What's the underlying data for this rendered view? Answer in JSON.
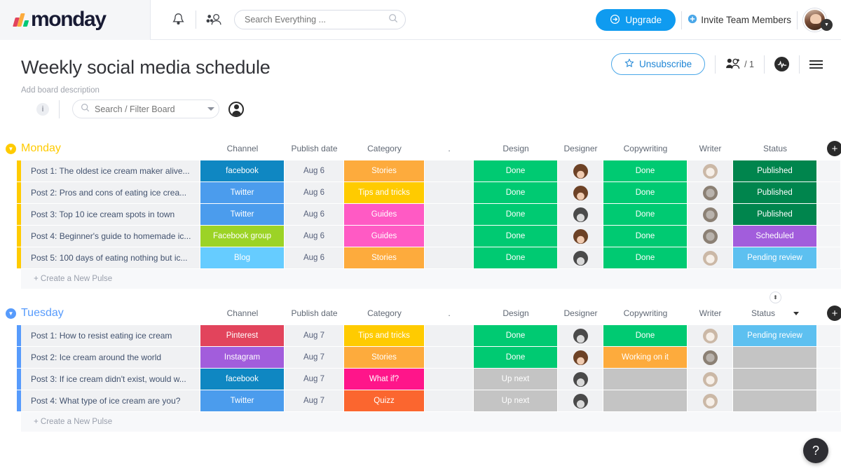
{
  "topbar": {
    "logo_text": "monday",
    "notifications_icon": "bell-icon",
    "teammates_icon": "people-icon",
    "search_placeholder": "Search Everything ...",
    "search_value": "",
    "search_icon": "search-icon",
    "upgrade_label": "Upgrade",
    "upgrade_icon": "arrow-circle-icon",
    "invite_label": "Invite Team Members",
    "invite_icon": "plus-circle-icon",
    "avatar": "user-avatar",
    "avatar_caret_icon": "chevron-down-icon",
    "accent_blue": "#0f9bf0"
  },
  "board_header": {
    "title": "Weekly social media schedule",
    "description_placeholder": "Add board description",
    "unsubscribe_label": "Unsubscribe",
    "unsubscribe_icon": "star-icon",
    "members_icon": "add-people-icon",
    "members_count": "/ 1",
    "activity_icon": "activity-pulse-icon",
    "menu_icon": "hamburger-icon"
  },
  "filter_bar": {
    "info_icon": "info-icon",
    "info_label": "i",
    "search_icon": "search-icon",
    "search_placeholder": "Search / Filter Board",
    "search_value": "",
    "dropdown_icon": "chevron-down-icon",
    "person_filter_icon": "person-filter-icon"
  },
  "columns": [
    {
      "label": "Channel",
      "width": 120
    },
    {
      "label": "Publish date",
      "width": 85
    },
    {
      "label": "Category",
      "width": 115
    },
    {
      "label": ".",
      "width": 70
    },
    {
      "label": "Design",
      "width": 120
    },
    {
      "label": "Designer",
      "width": 65
    },
    {
      "label": "Copywriting",
      "width": 120
    },
    {
      "label": "Writer",
      "width": 65
    },
    {
      "label": "Status",
      "width": 120
    }
  ],
  "add_column_icon": "plus-circle-icon",
  "groups": [
    {
      "name": "Monday",
      "color": "#ffcb00",
      "collapse_icon": "chevron-down-icon",
      "has_sort_indicator": false,
      "has_status_caret": false,
      "new_pulse_label": "+ Create a New Pulse",
      "rows": [
        {
          "name": "Post 1: The oldest ice cream maker alive...",
          "channel": {
            "label": "facebook",
            "color": "#0f87c2"
          },
          "date": "Aug 6",
          "category": {
            "label": "Stories",
            "color": "#fdab3d"
          },
          "design": {
            "label": "Done",
            "color": "#00ca72"
          },
          "designer": "woman",
          "copywriting": {
            "label": "Done",
            "color": "#00ca72"
          },
          "writer": "cat1",
          "status": {
            "label": "Published",
            "color": "#00854d"
          }
        },
        {
          "name": "Post 2: Pros and cons of eating ice crea...",
          "channel": {
            "label": "Twitter",
            "color": "#4b9ced"
          },
          "date": "Aug 6",
          "category": {
            "label": "Tips and tricks",
            "color": "#ffcb00"
          },
          "design": {
            "label": "Done",
            "color": "#00ca72"
          },
          "designer": "woman",
          "copywriting": {
            "label": "Done",
            "color": "#00ca72"
          },
          "writer": "cat2",
          "status": {
            "label": "Published",
            "color": "#00854d"
          }
        },
        {
          "name": "Post 3: Top 10 ice cream spots in town",
          "channel": {
            "label": "Twitter",
            "color": "#4b9ced"
          },
          "date": "Aug 6",
          "category": {
            "label": "Guides",
            "color": "#ff5ac4"
          },
          "design": {
            "label": "Done",
            "color": "#00ca72"
          },
          "designer": "man",
          "copywriting": {
            "label": "Done",
            "color": "#00ca72"
          },
          "writer": "cat2",
          "status": {
            "label": "Published",
            "color": "#00854d"
          }
        },
        {
          "name": "Post 4: Beginner's guide to homemade ic...",
          "channel": {
            "label": "Facebook group",
            "color": "#9cd326"
          },
          "date": "Aug 6",
          "category": {
            "label": "Guides",
            "color": "#ff5ac4"
          },
          "design": {
            "label": "Done",
            "color": "#00ca72"
          },
          "designer": "woman",
          "copywriting": {
            "label": "Done",
            "color": "#00ca72"
          },
          "writer": "cat2",
          "status": {
            "label": "Scheduled",
            "color": "#a25ddc"
          }
        },
        {
          "name": "Post 5: 100 days of eating nothing but ic...",
          "channel": {
            "label": "Blog",
            "color": "#66ccff"
          },
          "date": "Aug 6",
          "category": {
            "label": "Stories",
            "color": "#fdab3d"
          },
          "design": {
            "label": "Done",
            "color": "#00ca72"
          },
          "designer": "man",
          "copywriting": {
            "label": "Done",
            "color": "#00ca72"
          },
          "writer": "cat1",
          "status": {
            "label": "Pending review",
            "color": "#5dc0f0"
          }
        }
      ]
    },
    {
      "name": "Tuesday",
      "color": "#579bfc",
      "collapse_icon": "chevron-down-icon",
      "has_sort_indicator": true,
      "has_status_caret": true,
      "sort_icon": "sort-updown-icon",
      "status_caret_icon": "chevron-down-icon",
      "new_pulse_label": "+ Create a New Pulse",
      "rows": [
        {
          "name": "Post 1: How to resist eating ice cream",
          "channel": {
            "label": "Pinterest",
            "color": "#e2445c"
          },
          "date": "Aug 7",
          "category": {
            "label": "Tips and tricks",
            "color": "#ffcb00"
          },
          "design": {
            "label": "Done",
            "color": "#00ca72"
          },
          "designer": "man",
          "copywriting": {
            "label": "Done",
            "color": "#00ca72"
          },
          "writer": "cat1",
          "status": {
            "label": "Pending review",
            "color": "#5dc0f0"
          }
        },
        {
          "name": "Post 2: Ice cream around the world",
          "channel": {
            "label": "Instagram",
            "color": "#a25ddc"
          },
          "date": "Aug 7",
          "category": {
            "label": "Stories",
            "color": "#fdab3d"
          },
          "design": {
            "label": "Done",
            "color": "#00ca72"
          },
          "designer": "woman",
          "copywriting": {
            "label": "Working on it",
            "color": "#fdab3d"
          },
          "writer": "cat2",
          "status": {
            "label": "",
            "color": "#c4c4c4"
          }
        },
        {
          "name": "Post 3: If ice cream didn't exist, would w...",
          "channel": {
            "label": "facebook",
            "color": "#0f87c2"
          },
          "date": "Aug 7",
          "category": {
            "label": "What if?",
            "color": "#ff158a"
          },
          "design": {
            "label": "Up next",
            "color": "#c4c4c4"
          },
          "designer": "man",
          "copywriting": {
            "label": "",
            "color": "#c4c4c4"
          },
          "writer": "cat1",
          "status": {
            "label": "",
            "color": "#c4c4c4"
          }
        },
        {
          "name": "Post 4: What type of ice cream are you?",
          "channel": {
            "label": "Twitter",
            "color": "#4b9ced"
          },
          "date": "Aug 7",
          "category": {
            "label": "Quizz",
            "color": "#fb662f"
          },
          "design": {
            "label": "Up next",
            "color": "#c4c4c4"
          },
          "designer": "man",
          "copywriting": {
            "label": "",
            "color": "#c4c4c4"
          },
          "writer": "cat1",
          "status": {
            "label": "",
            "color": "#c4c4c4"
          }
        }
      ]
    }
  ],
  "help_fab": {
    "label": "?",
    "icon": "question-mark-icon"
  }
}
